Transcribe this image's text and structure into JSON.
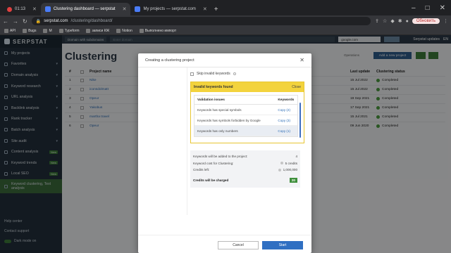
{
  "browser": {
    "time": "01:13",
    "tabs": [
      {
        "label": "Clustering dashboard — serpstat",
        "active": true
      },
      {
        "label": "My projects — serpstat.com",
        "active": false
      }
    ],
    "url_domain": "serpstat.com",
    "url_path": "/clustering/dashboard/",
    "update_label": "Обновить",
    "bookmarks": [
      "API",
      "Bugs",
      "M",
      "Typeform",
      "записи КЖ",
      "Notion",
      "Выполнено импорт"
    ]
  },
  "sidebar": {
    "logo": "SERPSTAT",
    "items": [
      {
        "label": "My projects"
      },
      {
        "label": "Favorites",
        "chev": true
      },
      {
        "label": "Domain analysis",
        "chev": true
      },
      {
        "label": "Keyword research",
        "chev": true
      },
      {
        "label": "URL analysis",
        "chev": true
      },
      {
        "label": "Backlink analysis",
        "chev": true
      },
      {
        "label": "Rank tracker",
        "chev": true
      },
      {
        "label": "Batch analysis",
        "chev": true
      },
      {
        "label": "Site audit",
        "chev": true
      },
      {
        "label": "Content analysis",
        "new": "New"
      },
      {
        "label": "Keyword trends",
        "new": "New"
      },
      {
        "label": "Local SEO",
        "new": "New"
      },
      {
        "label": "Keyword clustering, Text analysis",
        "active": true
      }
    ],
    "bottom": {
      "help": "Help center",
      "support": "Contact support",
      "dark": "Dark mode on"
    }
  },
  "main": {
    "domain_select": "Domain with subdomains",
    "search_placeholder": "Enter domain",
    "db_select": "google.com",
    "updates": "Serpstat updates",
    "lang": "EN",
    "title": "Clustering",
    "operations": "Operations",
    "add_project": "Add a new project",
    "headers": {
      "num": "#",
      "name": "Project name",
      "date": "Last update",
      "status": "Clustering status"
    },
    "rows": [
      {
        "num": "1",
        "name": "Nike",
        "date": "15 Jul 2022",
        "status": "Completed"
      },
      {
        "num": "2",
        "name": "iconsdolmatt",
        "date": "15 Jul 2022",
        "status": "Completed"
      },
      {
        "num": "3",
        "name": "Opeur",
        "date": "19 Sep 2021",
        "status": "Completed"
      },
      {
        "num": "4",
        "name": "Yakobus",
        "date": "17 Sep 2021",
        "status": "Completed"
      },
      {
        "num": "5",
        "name": "martha travel",
        "date": "15 Jul 2021",
        "status": "Completed"
      },
      {
        "num": "6",
        "name": "Opeur",
        "date": "09 Jun 2020",
        "status": "Completed"
      }
    ]
  },
  "modal": {
    "title": "Creating a clustering project",
    "skip_label": "Skip invalid keywords",
    "warning_title": "Invalid keywords found",
    "warning_close": "Close",
    "validation_header": "Validation issues",
    "keywords_header": "Keywords",
    "issues": [
      {
        "label": "Keywords has special symbols",
        "copy": "Copy (2)"
      },
      {
        "label": "Keywords has symbols forbidden by Google",
        "copy": "Copy (3)"
      },
      {
        "label": "Keywords has only numbers",
        "copy": "Copy (1)"
      }
    ],
    "summary": {
      "added_label": "Keywords will be added to the project:",
      "added_value": "4",
      "cost_label": "Keyword cost for Clustering:",
      "cost_value": "5 credits",
      "left_label": "Credits left:",
      "left_value": "1,000,000",
      "charged_label": "Credits will be charged",
      "charged_value": "20"
    },
    "cancel": "Cancel",
    "start": "Start"
  }
}
